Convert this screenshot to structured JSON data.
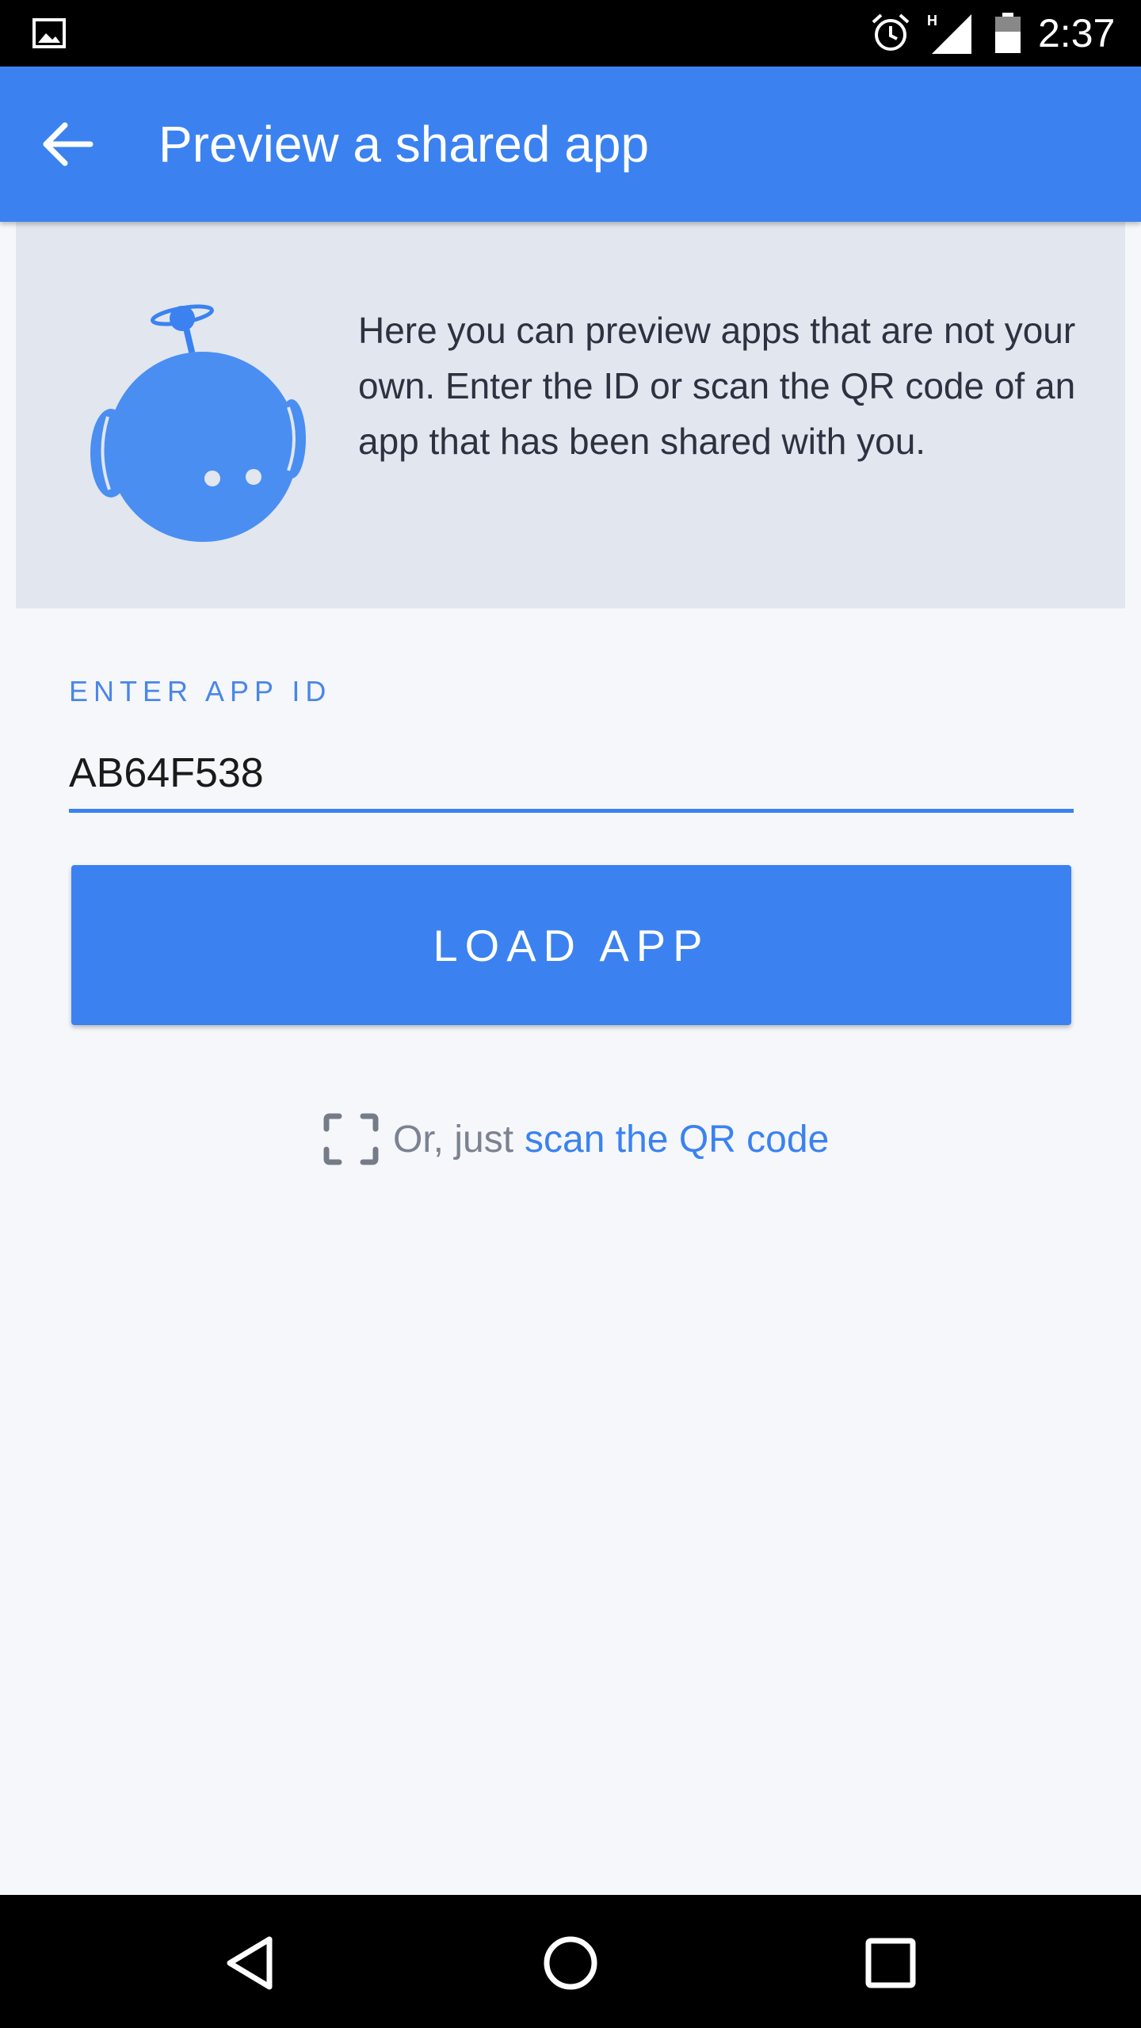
{
  "status_bar": {
    "time": "2:37",
    "network": "H",
    "icons": [
      "image-icon",
      "alarm-icon",
      "signal-icon",
      "battery-icon"
    ]
  },
  "app_bar": {
    "title": "Preview a shared app",
    "back_icon": "arrow-back-icon",
    "color": "#3b82f0"
  },
  "info_card": {
    "text": "Here you can preview apps that are not your own. Enter the ID or scan the QR code of an app that has been shared with you.",
    "illustration": "robot-mascot-icon"
  },
  "app_id_field": {
    "label": "ENTER APP ID",
    "value": "AB64F538"
  },
  "load_button": {
    "label": "LOAD APP"
  },
  "scan": {
    "prefix": "Or, just",
    "link": "scan the QR code",
    "icon": "qr-scan-icon"
  },
  "nav_bar": {
    "icons": [
      "back-triangle-icon",
      "home-circle-icon",
      "recents-square-icon"
    ]
  },
  "colors": {
    "accent": "#3b82f0",
    "card_background": "#e1e6ef",
    "page_background": "#f5f7fb"
  }
}
